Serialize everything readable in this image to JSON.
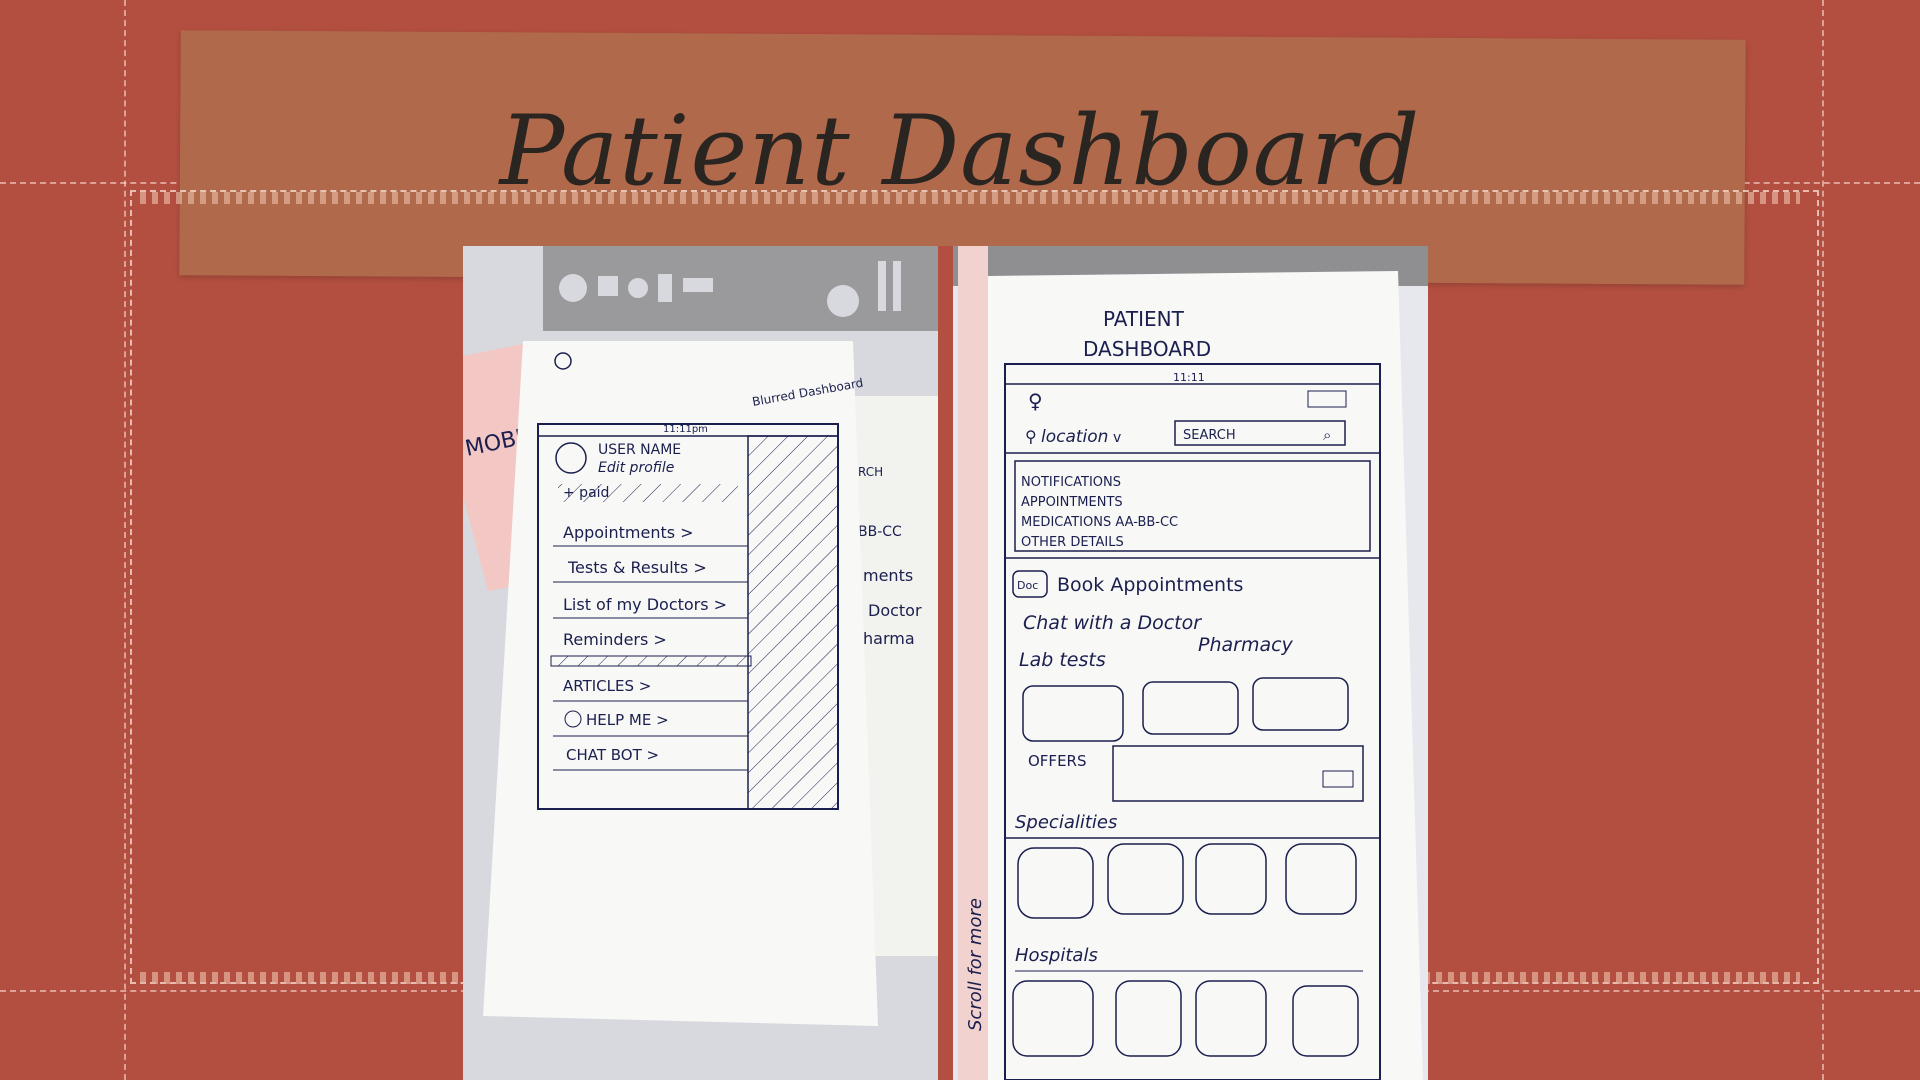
{
  "slide": {
    "title": "Patient Dashboard"
  },
  "left_sketch": {
    "note_label": "Blurred Dashboard",
    "status_time": "11:11pm",
    "profile_name": "USER NAME",
    "profile_edit": "Edit profile",
    "paid_label": "+ paid",
    "menu_items": [
      "Appointments >",
      "Tests & Results >",
      "List of my Doctors >",
      "Reminders >",
      "ARTICLES >",
      "HELP ME >",
      "CHAT BOT >"
    ],
    "background_fragments": [
      "RCH",
      "BB-CC",
      "ments",
      "Doctor",
      "harma"
    ],
    "pink_note": "MOBIL"
  },
  "right_sketch": {
    "heading_line1": "PATIENT",
    "heading_line2": "DASHBOARD",
    "status_time": "11:11",
    "location_label": "location",
    "search_placeholder": "SEARCH",
    "summary_items": [
      "NOTIFICATIONS",
      "APPOINTMENTS",
      "MEDICATIONS  AA-BB-CC",
      "OTHER DETAILS"
    ],
    "actions": {
      "book": "Book Appointments",
      "chat": "Chat with a Doctor",
      "lab": "Lab tests",
      "pharmacy": "Pharmacy"
    },
    "offers_label": "OFFERS",
    "specialities_label": "Specialities",
    "hospitals_label": "Hospitals",
    "scroll_note": "Scroll for more",
    "doc_badge": "Doc"
  }
}
